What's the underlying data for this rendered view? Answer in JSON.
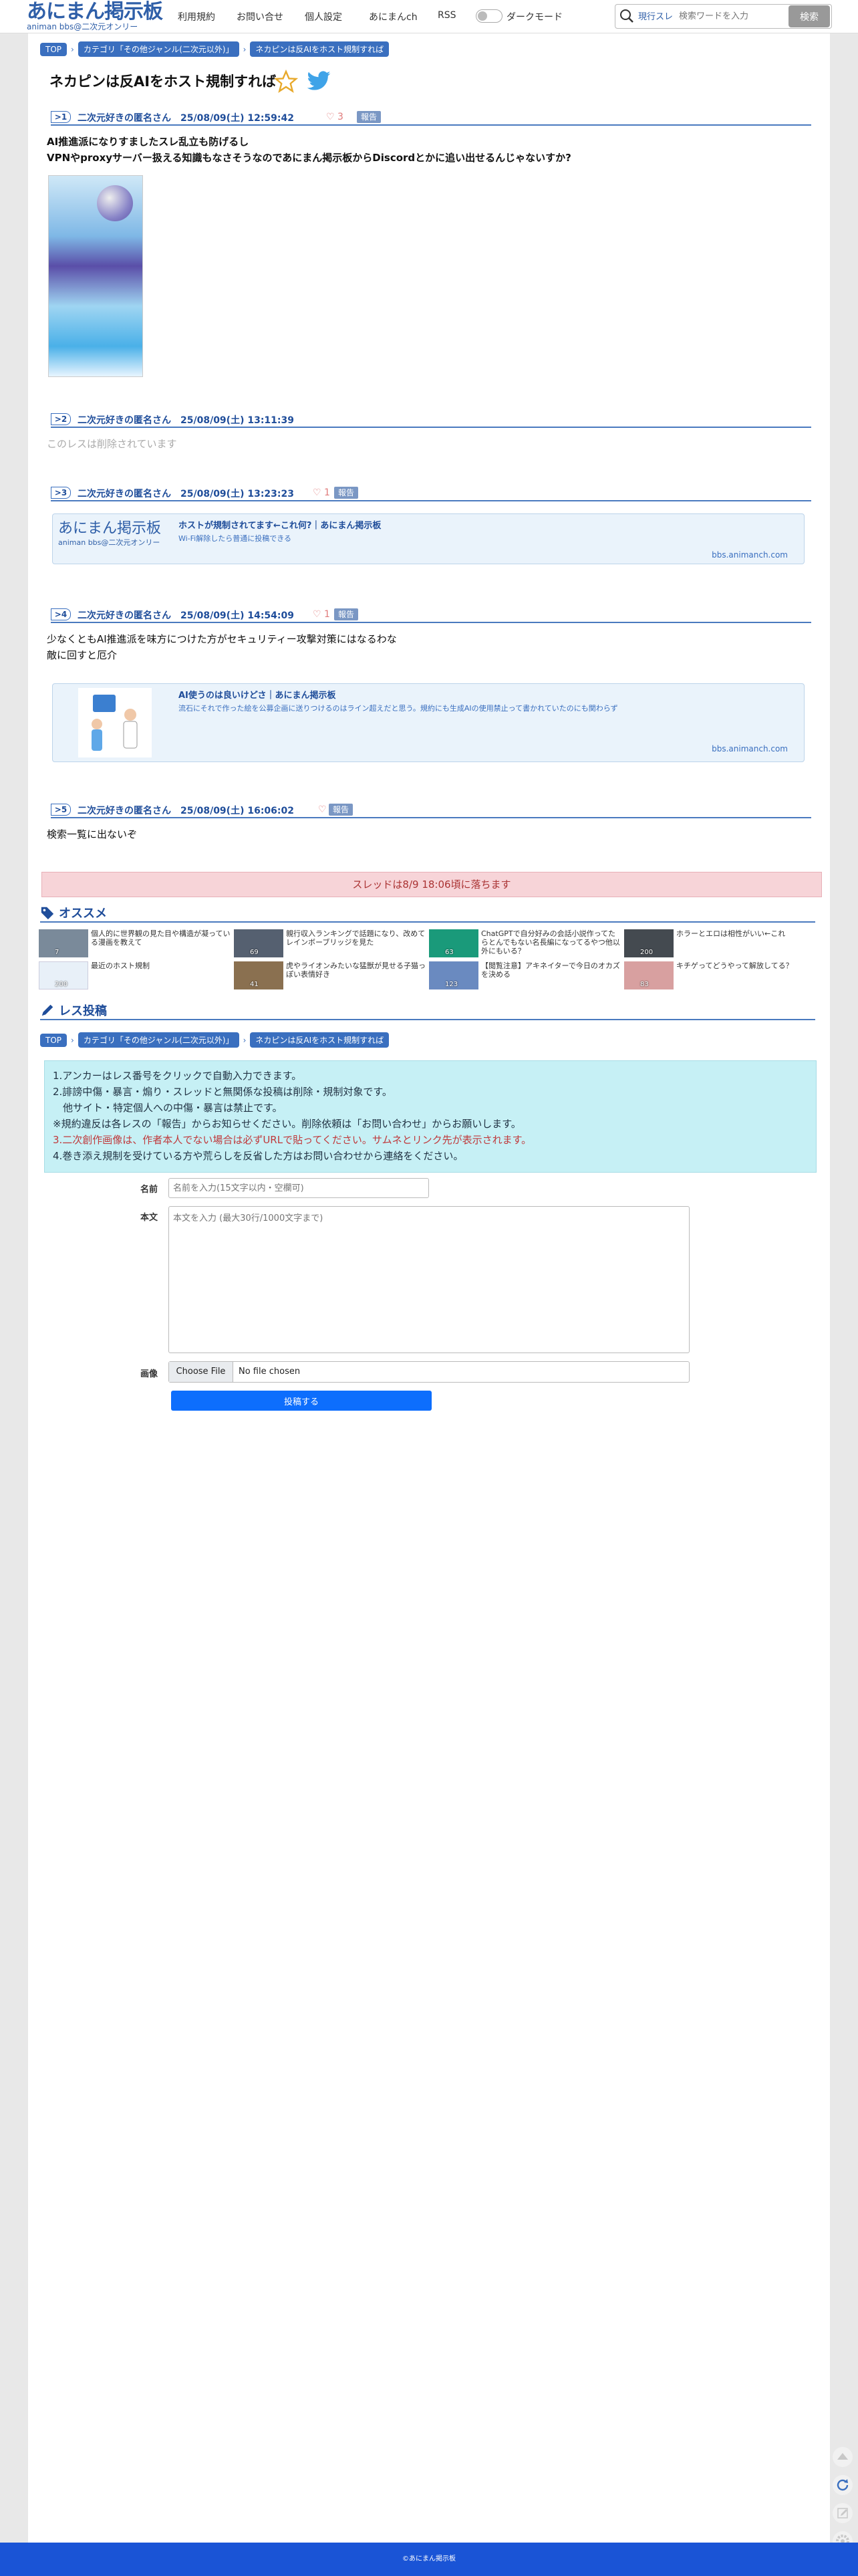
{
  "header": {
    "logo_main": "あにまん掲示板",
    "logo_sub": "animan bbs@二次元オンリー",
    "nav": [
      "利用規約",
      "お問い合せ",
      "個人設定",
      "あにまんch",
      "RSS"
    ],
    "darkmode_label": "ダークモード",
    "search_scope": "現行スレ",
    "search_placeholder": "検索ワードを入力",
    "search_button": "検索"
  },
  "breadcrumb": [
    "TOP",
    "カテゴリ「その他ジャンル(二次元以外)」",
    "ネカピンは反AIをホスト規制すれば"
  ],
  "thread_title": "ネカピンは反AIをホスト規制すれば",
  "posts": [
    {
      "num": ">1",
      "meta": "二次元好きの匿名さん　25/08/09(土) 12:59:42",
      "hearts": "♡ 3",
      "report": "報告",
      "lines": [
        "AI推進派になりすましたスレ乱立も防げるし",
        "VPNやproxyサーバー扱える知識もなさそうなのであにまん掲示板からDiscordとかに追い出せるんじゃないすか?"
      ]
    },
    {
      "num": ">2",
      "meta": "二次元好きの匿名さん　25/08/09(土) 13:11:39",
      "deleted": "このレスは削除されています"
    },
    {
      "num": ">3",
      "meta": "二次元好きの匿名さん　25/08/09(土) 13:23:23",
      "hearts": "♡ 1",
      "report": "報告",
      "card": {
        "logo": "あにまん掲示板",
        "logo_sub": "animan bbs@二次元オンリー",
        "title": "ホストが規制されてます←これ何?｜あにまん掲示板",
        "desc": "Wi-Fi解除したら普通に投稿できる",
        "domain": "bbs.animanch.com"
      }
    },
    {
      "num": ">4",
      "meta": "二次元好きの匿名さん　25/08/09(土) 14:54:09",
      "hearts": "♡ 1",
      "report": "報告",
      "lines": [
        "少なくともAI推進派を味方につけた方がセキュリティー攻撃対策にはなるわな",
        "敵に回すと厄介"
      ],
      "card": {
        "title": "AI使うのは良いけどさ｜あにまん掲示板",
        "desc": "流石にそれで作った絵を公募企画に送りつけるのはライン超えだと思う。規約にも生成AIの使用禁止って書かれていたのにも関わらず",
        "domain": "bbs.animanch.com"
      }
    },
    {
      "num": ">5",
      "meta": "二次元好きの匿名さん　25/08/09(土) 16:06:02",
      "hearts": "♡",
      "report": "報告",
      "lines": [
        "検索一覧に出ないぞ"
      ]
    }
  ],
  "deadline": "スレッドは8/9 18:06頃に落ちます",
  "recommend": {
    "title": "オススメ",
    "items": [
      {
        "text": "個人的に世界観の見た目や構造が凝っている漫画を教えて",
        "count": "7"
      },
      {
        "text": "親行収入ランキングで話題になり、改めてレインボーブリッジを見た",
        "count": "69"
      },
      {
        "text": "ChatGPTで自分好みの会話小説作ってたらとんでもない名長編になってるやつ他以外にもいる？",
        "count": "63"
      },
      {
        "text": "ホラーとエロは相性がいい←これ",
        "count": "200"
      },
      {
        "text": "最近のホスト規制",
        "count": "200"
      },
      {
        "text": "虎やライオンみたいな猛獣が見せる子猫っぽい表情好き",
        "count": "41"
      },
      {
        "text": "【閲覧注意】アキネイターで今日のオカズを決める",
        "count": "123"
      },
      {
        "text": "キチゲってどうやって解放してる？",
        "count": "83"
      }
    ]
  },
  "reply": {
    "title": "レス投稿",
    "rules": [
      "1.アンカーはレス番号をクリックで自動入力できます。",
      "2.誹謗中傷・暴言・煽り・スレッドと無関係な投稿は削除・規制対象です。",
      "　他サイト・特定個人への中傷・暴言は禁止です。",
      "※規約違反は各レスの「報告」からお知らせください。削除依頼は「お問い合わせ」からお願いします。",
      "3.二次創作画像は、作者本人でない場合は必ずURLで貼ってください。サムネとリンク先が表示されます。",
      "4.巻き添え規制を受けている方や荒らしを反省した方はお問い合わせから連絡をください。"
    ],
    "name_label": "名前",
    "name_placeholder": "名前を入力(15文字以内・空欄可)",
    "body_label": "本文",
    "body_placeholder": "本文を入力 (最大30行/1000文字まで)",
    "image_label": "画像",
    "file_button": "Choose File",
    "file_status": "No file chosen",
    "submit": "投稿する"
  },
  "footer": "©あにまん掲示板",
  "colors": {
    "accent": "#1f4d9a",
    "pill": "#3a6fbf",
    "footer": "#1a54d6",
    "submit": "#0d6efd"
  }
}
